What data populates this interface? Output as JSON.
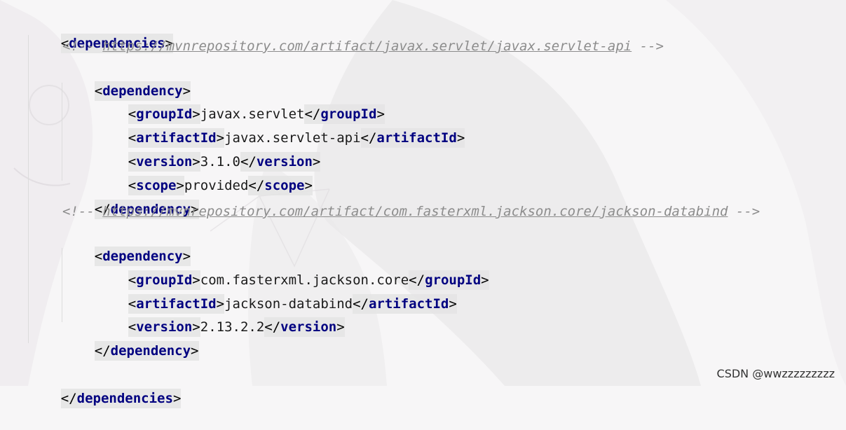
{
  "editor": {
    "lines": {
      "deps_open": {
        "open": "<",
        "name": "dependencies",
        "close": ">"
      },
      "comment1": {
        "open": "<!--",
        "url": "https://mvnrepository.com/artifact/javax.servlet/javax.servlet-api",
        "close": "-->"
      },
      "dep1_open": {
        "open": "<",
        "name": "dependency",
        "close": ">"
      },
      "dep1_group": {
        "tag": "groupId",
        "value": "javax.servlet"
      },
      "dep1_artifact": {
        "tag": "artifactId",
        "value": "javax.servlet-api"
      },
      "dep1_version": {
        "tag": "version",
        "value": "3.1.0"
      },
      "dep1_scope": {
        "tag": "scope",
        "value": "provided"
      },
      "dep1_close": {
        "open": "</",
        "name": "dependency",
        "close": ">"
      },
      "comment2": {
        "open": "<!--",
        "url": "https://mvnrepository.com/artifact/com.fasterxml.jackson.core/jackson-databind",
        "close": "-->"
      },
      "dep2_open": {
        "open": "<",
        "name": "dependency",
        "close": ">"
      },
      "dep2_group": {
        "tag": "groupId",
        "value": "com.fasterxml.jackson.core"
      },
      "dep2_artifact": {
        "tag": "artifactId",
        "value": "jackson-databind"
      },
      "dep2_version": {
        "tag": "version",
        "value": "2.13.2.2"
      },
      "dep2_close": {
        "open": "</",
        "name": "dependency",
        "close": ">"
      },
      "deps_close": {
        "open": "</",
        "name": "dependencies",
        "close": ">"
      }
    }
  },
  "watermark": {
    "text": "CSDN @wwzzzzzzzzz"
  },
  "colors": {
    "tag": "#000080",
    "comment": "#8c8c8c",
    "text": "#1a1a1a",
    "highlight": "#e4e4e4",
    "background": "#f7f6f7"
  }
}
